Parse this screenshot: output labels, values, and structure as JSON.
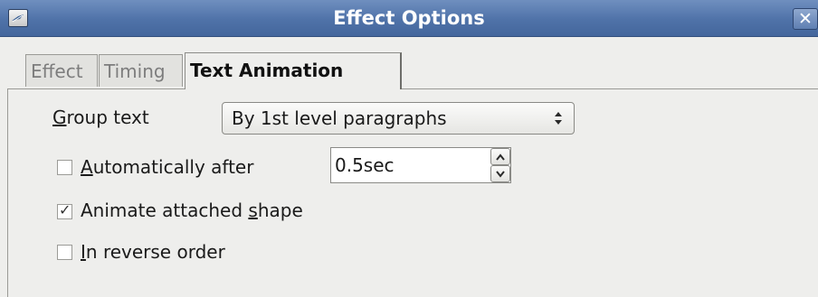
{
  "window": {
    "title": "Effect Options",
    "close_glyph": "✕",
    "app_icon": "app-icon"
  },
  "tabs": [
    {
      "label": "Effect",
      "active": false
    },
    {
      "label": "Timing",
      "active": false
    },
    {
      "label": "Text Animation",
      "active": true
    }
  ],
  "group_text": {
    "label_mnemonic": "G",
    "label_rest": "roup text",
    "value": "By 1st level paragraphs"
  },
  "automatically_after": {
    "label_mnemonic": "A",
    "label_rest": "utomatically after",
    "checked": false,
    "value": "0.5sec"
  },
  "animate_attached_shape": {
    "label_pre": "Animate attached ",
    "label_mnemonic": "s",
    "label_rest": "hape",
    "checked": true,
    "check_glyph": "✓"
  },
  "in_reverse_order": {
    "label_mnemonic": "I",
    "label_rest": "n reverse order",
    "checked": false
  }
}
